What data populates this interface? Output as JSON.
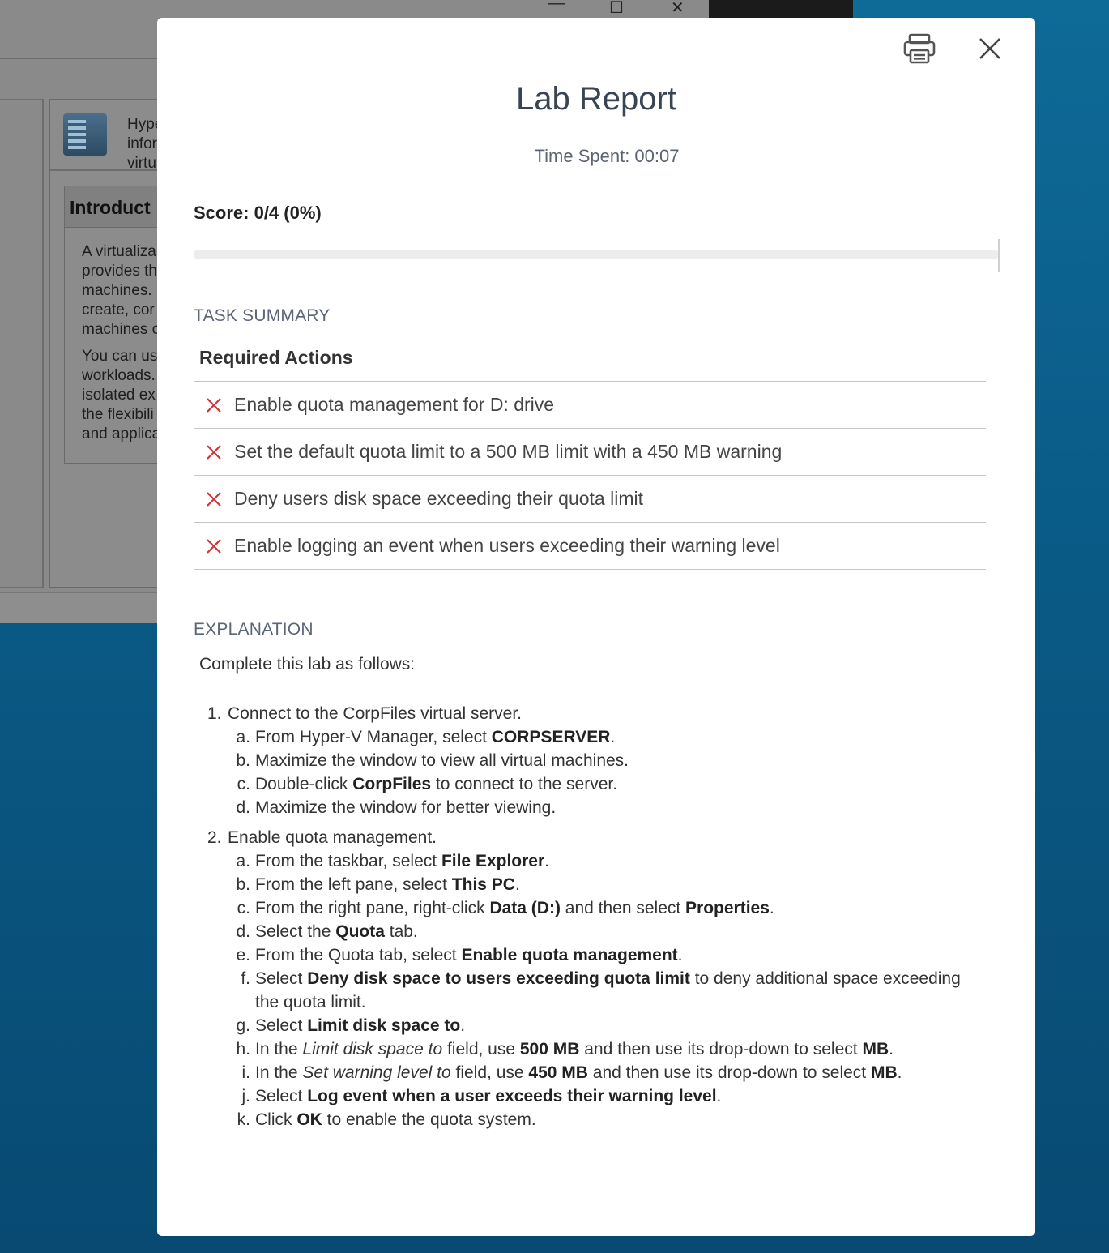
{
  "background": {
    "window_controls": [
      "—",
      "☐",
      "✕"
    ],
    "snippet_lines": [
      "Hype",
      "infor",
      "virtu"
    ],
    "intro_title": "Introduct",
    "intro_lines": [
      "A virtualiza",
      "provides th",
      "machines.",
      "create, cor",
      "machines c",
      "You can us",
      "workloads.",
      "isolated ex",
      "the flexibili",
      "and applica"
    ]
  },
  "modal": {
    "title": "Lab Report",
    "time_spent": "Time Spent: 00:07",
    "score": "Score: 0/4 (0%)",
    "score_fraction": 0,
    "print_icon": "printer-icon",
    "close_icon": "close-icon",
    "task_summary_label": "TASK SUMMARY",
    "required_actions_label": "Required Actions",
    "fail_color": "#d13438",
    "actions": [
      "Enable quota management for D: drive",
      "Set the default quota limit to a 500 MB limit with a 450 MB warning",
      "Deny users disk space exceeding their quota limit",
      "Enable logging an event when users exceeding their warning level"
    ],
    "explanation_label": "EXPLANATION",
    "explanation_intro": "Complete this lab as follows:",
    "steps": [
      {
        "num": "1.",
        "text": "Connect to the CorpFiles virtual server.",
        "subs": [
          {
            "letter": "a.",
            "parts": [
              [
                "n",
                "From Hyper-V Manager, select "
              ],
              [
                "b",
                "CORPSERVER"
              ],
              [
                "n",
                "."
              ]
            ]
          },
          {
            "letter": "b.",
            "parts": [
              [
                "n",
                "Maximize the window to view all virtual machines."
              ]
            ]
          },
          {
            "letter": "c.",
            "parts": [
              [
                "n",
                "Double-click "
              ],
              [
                "b",
                "CorpFiles"
              ],
              [
                "n",
                " to connect to the server."
              ]
            ]
          },
          {
            "letter": "d.",
            "parts": [
              [
                "n",
                "Maximize the window for better viewing."
              ]
            ]
          }
        ]
      },
      {
        "num": "2.",
        "text": "Enable quota management.",
        "subs": [
          {
            "letter": "a.",
            "parts": [
              [
                "n",
                "From the taskbar, select "
              ],
              [
                "b",
                "File Explorer"
              ],
              [
                "n",
                "."
              ]
            ]
          },
          {
            "letter": "b.",
            "parts": [
              [
                "n",
                "From the left pane, select "
              ],
              [
                "b",
                "This PC"
              ],
              [
                "n",
                "."
              ]
            ]
          },
          {
            "letter": "c.",
            "parts": [
              [
                "n",
                "From the right pane, right-click "
              ],
              [
                "b",
                "Data (D:)"
              ],
              [
                "n",
                " and then select "
              ],
              [
                "b",
                "Properties"
              ],
              [
                "n",
                "."
              ]
            ]
          },
          {
            "letter": "d.",
            "parts": [
              [
                "n",
                "Select the "
              ],
              [
                "b",
                "Quota"
              ],
              [
                "n",
                " tab."
              ]
            ]
          },
          {
            "letter": "e.",
            "parts": [
              [
                "n",
                "From the Quota tab, select "
              ],
              [
                "b",
                "Enable quota management"
              ],
              [
                "n",
                "."
              ]
            ]
          },
          {
            "letter": "f.",
            "parts": [
              [
                "n",
                "Select "
              ],
              [
                "b",
                "Deny disk space to users exceeding quota limit"
              ],
              [
                "n",
                " to deny additional space exceeding the quota limit."
              ]
            ]
          },
          {
            "letter": "g.",
            "parts": [
              [
                "n",
                "Select "
              ],
              [
                "b",
                "Limit disk space to"
              ],
              [
                "n",
                "."
              ]
            ]
          },
          {
            "letter": "h.",
            "parts": [
              [
                "n",
                "In the "
              ],
              [
                "i",
                "Limit disk space to"
              ],
              [
                "n",
                " field, use "
              ],
              [
                "b",
                "500 MB"
              ],
              [
                "n",
                " and then use its drop-down to select "
              ],
              [
                "b",
                "MB"
              ],
              [
                "n",
                "."
              ]
            ]
          },
          {
            "letter": "i.",
            "parts": [
              [
                "n",
                "In the "
              ],
              [
                "i",
                "Set warning level to"
              ],
              [
                "n",
                " field, use "
              ],
              [
                "b",
                "450 MB"
              ],
              [
                "n",
                " and then use its drop-down to select "
              ],
              [
                "b",
                "MB"
              ],
              [
                "n",
                "."
              ]
            ]
          },
          {
            "letter": "j.",
            "parts": [
              [
                "n",
                "Select "
              ],
              [
                "b",
                "Log event when a user exceeds their warning level"
              ],
              [
                "n",
                "."
              ]
            ]
          },
          {
            "letter": "k.",
            "parts": [
              [
                "n",
                "Click "
              ],
              [
                "b",
                "OK"
              ],
              [
                "n",
                " to enable the quota system."
              ]
            ]
          }
        ]
      }
    ]
  }
}
